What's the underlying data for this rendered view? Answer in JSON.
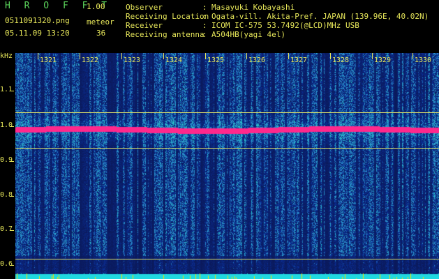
{
  "header": {
    "app_title": "H R O F F T",
    "app_version": "1.00",
    "filename": "0511091320.png",
    "detection_label": "meteor",
    "datetime": "05.11.09 13:20",
    "detection_count": "36",
    "info": [
      {
        "key": "Observer",
        "value": "Masayuki Kobayashi"
      },
      {
        "key": "Receiving Location",
        "value": "Ogata-vill. Akita-Pref. JAPAN (139.96E, 40.02N)"
      },
      {
        "key": "Receiver",
        "value": "ICOM IC-575 53.7492(@LCD)MHz USB"
      },
      {
        "key": "Receiving antenna",
        "value": "A504HB(yagi 4el)"
      }
    ],
    "separator": ":"
  },
  "spectrogram": {
    "y_unit": "kHz",
    "y_ticks": [
      "1.1",
      "1.0",
      "0.9",
      "0.8",
      "0.7",
      "0.6"
    ],
    "x_ticks": [
      "1321",
      "1322",
      "1323",
      "1324",
      "1325",
      "1326",
      "1327",
      "1328",
      "1329",
      "1330"
    ],
    "colors": {
      "background": "#0a1a6a",
      "noise": "#2a57c8",
      "mid": "#35c8c8",
      "hot": "#ff2f8a",
      "axis": "#e7e75a",
      "guide": "#d8dc6a"
    }
  }
}
